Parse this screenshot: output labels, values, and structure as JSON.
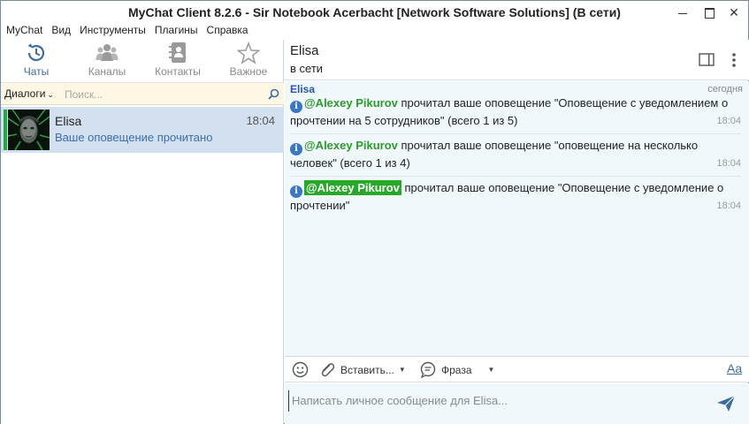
{
  "window": {
    "title": "MyChat Client 8.2.6 - Sir Notebook Acerbacht [Network Software Solutions] (В сети)"
  },
  "menu": [
    "MyChat",
    "Вид",
    "Инструменты",
    "Плагины",
    "Справка"
  ],
  "nav_tabs": [
    {
      "label": "Чаты",
      "icon": "history-icon",
      "active": true
    },
    {
      "label": "Каналы",
      "icon": "people-icon",
      "active": false
    },
    {
      "label": "Контакты",
      "icon": "address-book-icon",
      "active": false
    },
    {
      "label": "Важное",
      "icon": "star-icon",
      "active": false
    }
  ],
  "dialog_filter": {
    "selected": "Диалоги",
    "search_placeholder": "Поиск..."
  },
  "chat_list": [
    {
      "name": "Elisa",
      "time": "18:04",
      "preview": "Ваше оповещение прочитано",
      "status_color": "#1faa3c"
    }
  ],
  "chat": {
    "name": "Elisa",
    "status": "в сети",
    "date_label": "сегодня",
    "sender": "Elisa",
    "messages": [
      {
        "mention": "@Alexey Pikurov",
        "text": " прочитал ваше оповещение \"Оповещение с уведомлением о прочтении на 5 сотрудников\" (всего 1 из 5)",
        "time": "18:04"
      },
      {
        "mention": "@Alexey Pikurov",
        "text": " прочитал ваше оповещение \"оповещение на несколько человек\" (всего 1 из 4)",
        "time": "18:04"
      },
      {
        "mention": "@Alexey Pikurov",
        "text": " прочитал ваше оповещение \"Оповещение с уведомление о прочтении\"",
        "time": "18:04"
      }
    ]
  },
  "toolbar": {
    "paste_label": "Вставить...",
    "phrase_label": "Фраза",
    "font_label": "Aa"
  },
  "composer": {
    "placeholder": "Написать личное сообщение для Elisa..."
  },
  "colors": {
    "accent": "#3d6ca3",
    "mention": "#2a9d2a",
    "online": "#1faa3c",
    "info": "#3b76c4"
  }
}
